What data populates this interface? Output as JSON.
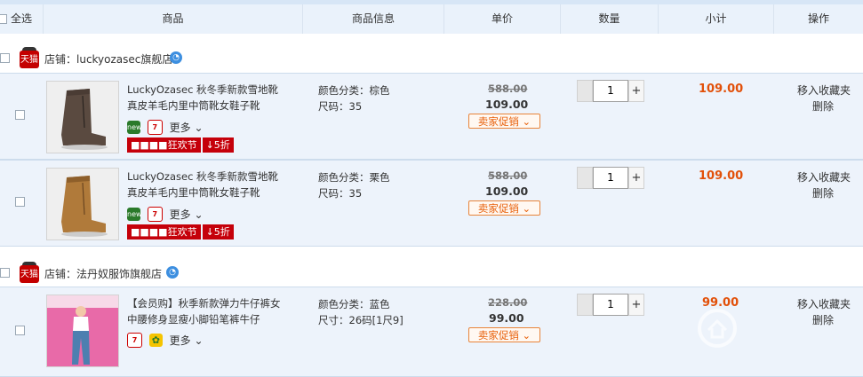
{
  "header": {
    "select_all": "全选",
    "col_goods": "商品",
    "col_info": "商品信息",
    "col_price": "单价",
    "col_qty": "数量",
    "col_subtotal": "小计",
    "col_ops": "操作"
  },
  "shops": [
    {
      "badge": "天猫",
      "label": "店铺：luckyozasec旗舰店",
      "items": [
        {
          "title": "LuckyOzasec 秋冬季新款雪地靴真皮羊毛内里中筒靴女鞋子靴",
          "color": "颜色分类：棕色",
          "size": "尺码：35",
          "old_price": "588.00",
          "price": "109.00",
          "promo_btn": "卖家促销",
          "qty": "1",
          "subtotal": "109.00",
          "op_fav": "移入收藏夹",
          "op_del": "删除",
          "more": "更多",
          "promo_tag": "狂欢节",
          "discount_tag": "↓5折",
          "boot_color": "#5a4a40"
        },
        {
          "title": "LuckyOzasec 秋冬季新款雪地靴真皮羊毛内里中筒靴女鞋子靴",
          "color": "颜色分类：栗色",
          "size": "尺码：35",
          "old_price": "588.00",
          "price": "109.00",
          "promo_btn": "卖家促销",
          "qty": "1",
          "subtotal": "109.00",
          "op_fav": "移入收藏夹",
          "op_del": "删除",
          "more": "更多",
          "promo_tag": "狂欢节",
          "discount_tag": "↓5折",
          "boot_color": "#b07a3a"
        }
      ]
    },
    {
      "badge": "天猫",
      "label": "店铺：法丹奴服饰旗舰店",
      "items": [
        {
          "title": "【会员购】秋季新款弹力牛仔裤女中腰修身显瘦小脚铅笔裤牛仔",
          "color": "颜色分类：蓝色",
          "size": "尺寸：26码[1尺9]",
          "old_price": "228.00",
          "price": "99.00",
          "promo_btn": "卖家促销",
          "qty": "1",
          "subtotal": "99.00",
          "op_fav": "移入收藏夹",
          "op_del": "删除",
          "more": "更多"
        }
      ]
    }
  ],
  "colors": {
    "accent": "#e25009",
    "header_bg": "#eaf2fb",
    "item_bg": "#edf3fb",
    "promo_red": "#c5000a"
  },
  "icons": {
    "new": "new-icon",
    "seven": "seven-day-return-icon",
    "flower": "flower-icon"
  }
}
